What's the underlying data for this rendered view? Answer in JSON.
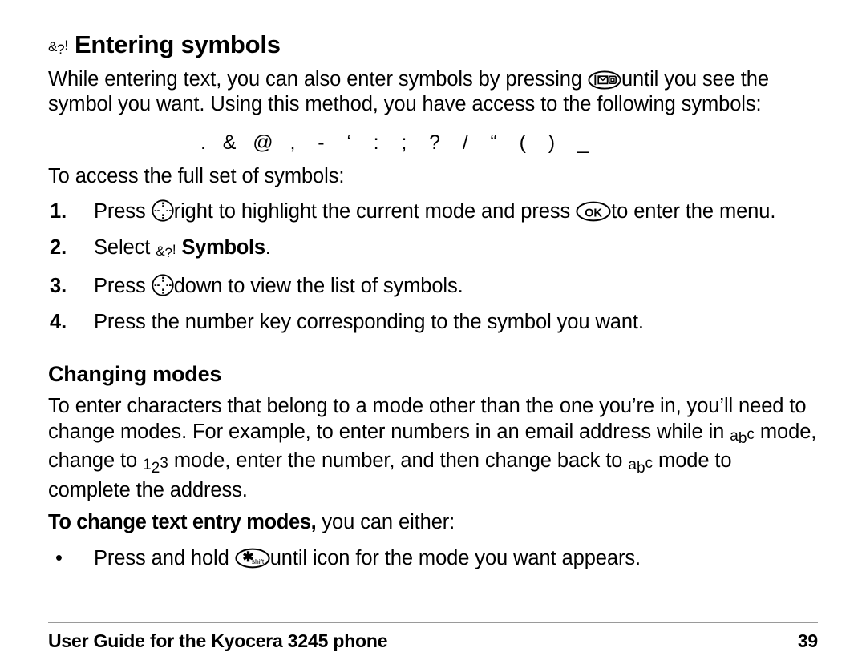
{
  "document": {
    "section1": {
      "heading": "Entering symbols",
      "heading_icon": "symbols-mode-icon",
      "intro_part1": "While entering text, you can also enter symbols by pressing",
      "intro_part2": "until you see the symbol you want. Using this method, you have access to the following symbols:",
      "symbols_list": ".   &   @   ,    -    ‘    :    ;    ?    /    “    (    )    _",
      "access_line": "To access the full set of symbols:",
      "steps": [
        {
          "number": "1.",
          "text_part1": "Press",
          "icon1": "navigation-key-icon",
          "text_part2": "right to highlight the current mode and press",
          "icon2": "ok-key-icon",
          "text_part3": "to enter the menu."
        },
        {
          "number": "2.",
          "text_part1": "Select",
          "icon1": "symbols-mode-icon",
          "bold_text": "Symbols",
          "text_part3": "."
        },
        {
          "number": "3.",
          "text_part1": "Press",
          "icon1": "navigation-key-icon",
          "text_part3": "down to view the list of symbols."
        },
        {
          "number": "4.",
          "text_part1": "Press the number key corresponding to the symbol you want."
        }
      ]
    },
    "section2": {
      "heading": "Changing modes",
      "para1_part1": "To enter characters that belong to a mode other than the one you’re in, you’ll need to change modes. For example, to enter numbers in an email address while in",
      "para1_part2": "mode, change to",
      "para1_part3": "mode, enter the number, and then change back to",
      "para1_part4": "mode to complete the address.",
      "mode_abc_icon": "abc-mode-icon",
      "mode_123_icon": "123-mode-icon",
      "lead_bold": "To change text entry modes,",
      "lead_rest": " you can either:",
      "bullets": [
        {
          "marker": "•",
          "text_part1": "Press and hold",
          "icon1": "shift-key-icon",
          "text_part3": "until icon for the mode you want appears."
        }
      ]
    },
    "footer": {
      "left": "User Guide for the Kyocera 3245 phone",
      "page_number": "39"
    },
    "icon_glyphs": {
      "symbols_amp": "&",
      "symbols_q": "?",
      "symbols_bang": "!",
      "abc_a": "a",
      "abc_b": "b",
      "abc_c": "c",
      "num_1": "1",
      "num_2": "2",
      "num_3": "3",
      "ok_label": "OK",
      "shift_label": "shift",
      "shift_star": "✱"
    },
    "colors": {
      "text": "#000000",
      "background": "#ffffff",
      "footer_rule": "#9a9a9a"
    }
  }
}
